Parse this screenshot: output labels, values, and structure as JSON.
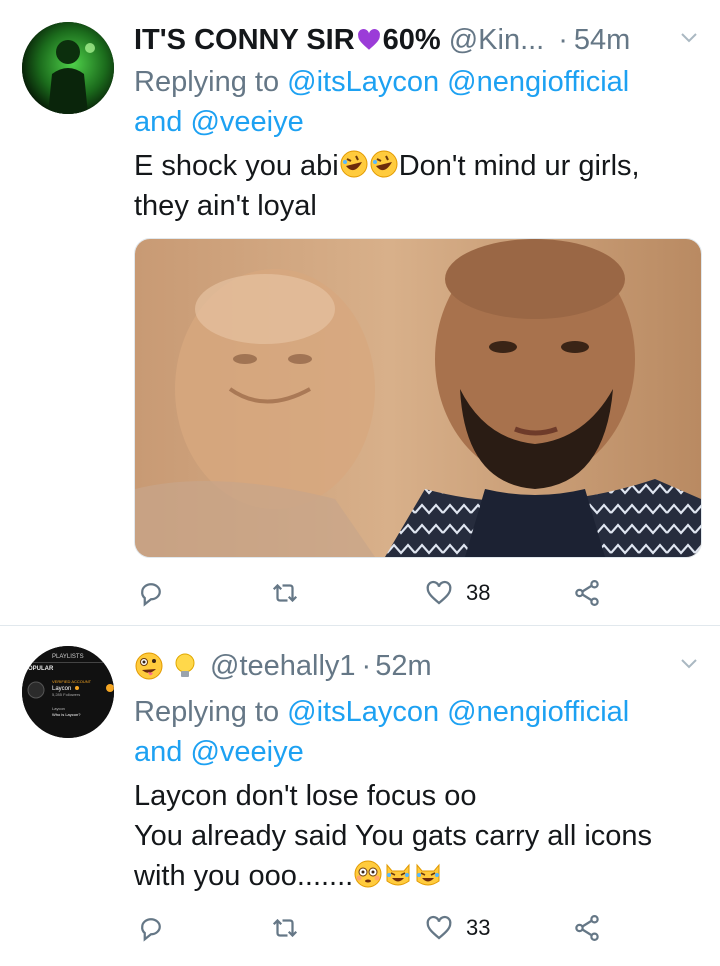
{
  "tweets": [
    {
      "name": "IT'S CONNY SIR",
      "name_suffix": "60%",
      "handle": "@Kin...",
      "time": "54m",
      "replying_prefix": "Replying to",
      "mention1": "@itsLaycon",
      "mention2": "@nengiofficial",
      "and": "and",
      "mention3": "@veeiye",
      "text_line1_a": "E shock you abi",
      "text_line1_b": "Don't mind ur girls,",
      "text_line2": "they ain't loyal",
      "likes": "38"
    },
    {
      "handle": "@teehally1",
      "time": "52m",
      "replying_prefix": "Replying to",
      "mention1": "@itsLaycon",
      "mention2": "@nengiofficial",
      "and": "and",
      "mention3": "@veeiye",
      "text_line1": "Laycon don't lose focus oo",
      "text_line2": "You already said You gats carry all icons",
      "text_line3": "with you ooo.......",
      "likes": "33",
      "avatar_text": {
        "tab": "PLAYLISTS",
        "section": "POPULAR",
        "badge": "VERIFIED ACCOUNT",
        "title": "Laycon",
        "followers": "5,285 Followers",
        "item": "Laycon",
        "item2": "Who is Laycon?"
      }
    }
  ],
  "colors": {
    "link": "#1da1f2",
    "muted": "#657786",
    "text": "#14171a",
    "divider": "#e1e8ed"
  },
  "icons": [
    "reply-icon",
    "retweet-icon",
    "like-icon",
    "share-icon",
    "chevron-down-icon"
  ]
}
